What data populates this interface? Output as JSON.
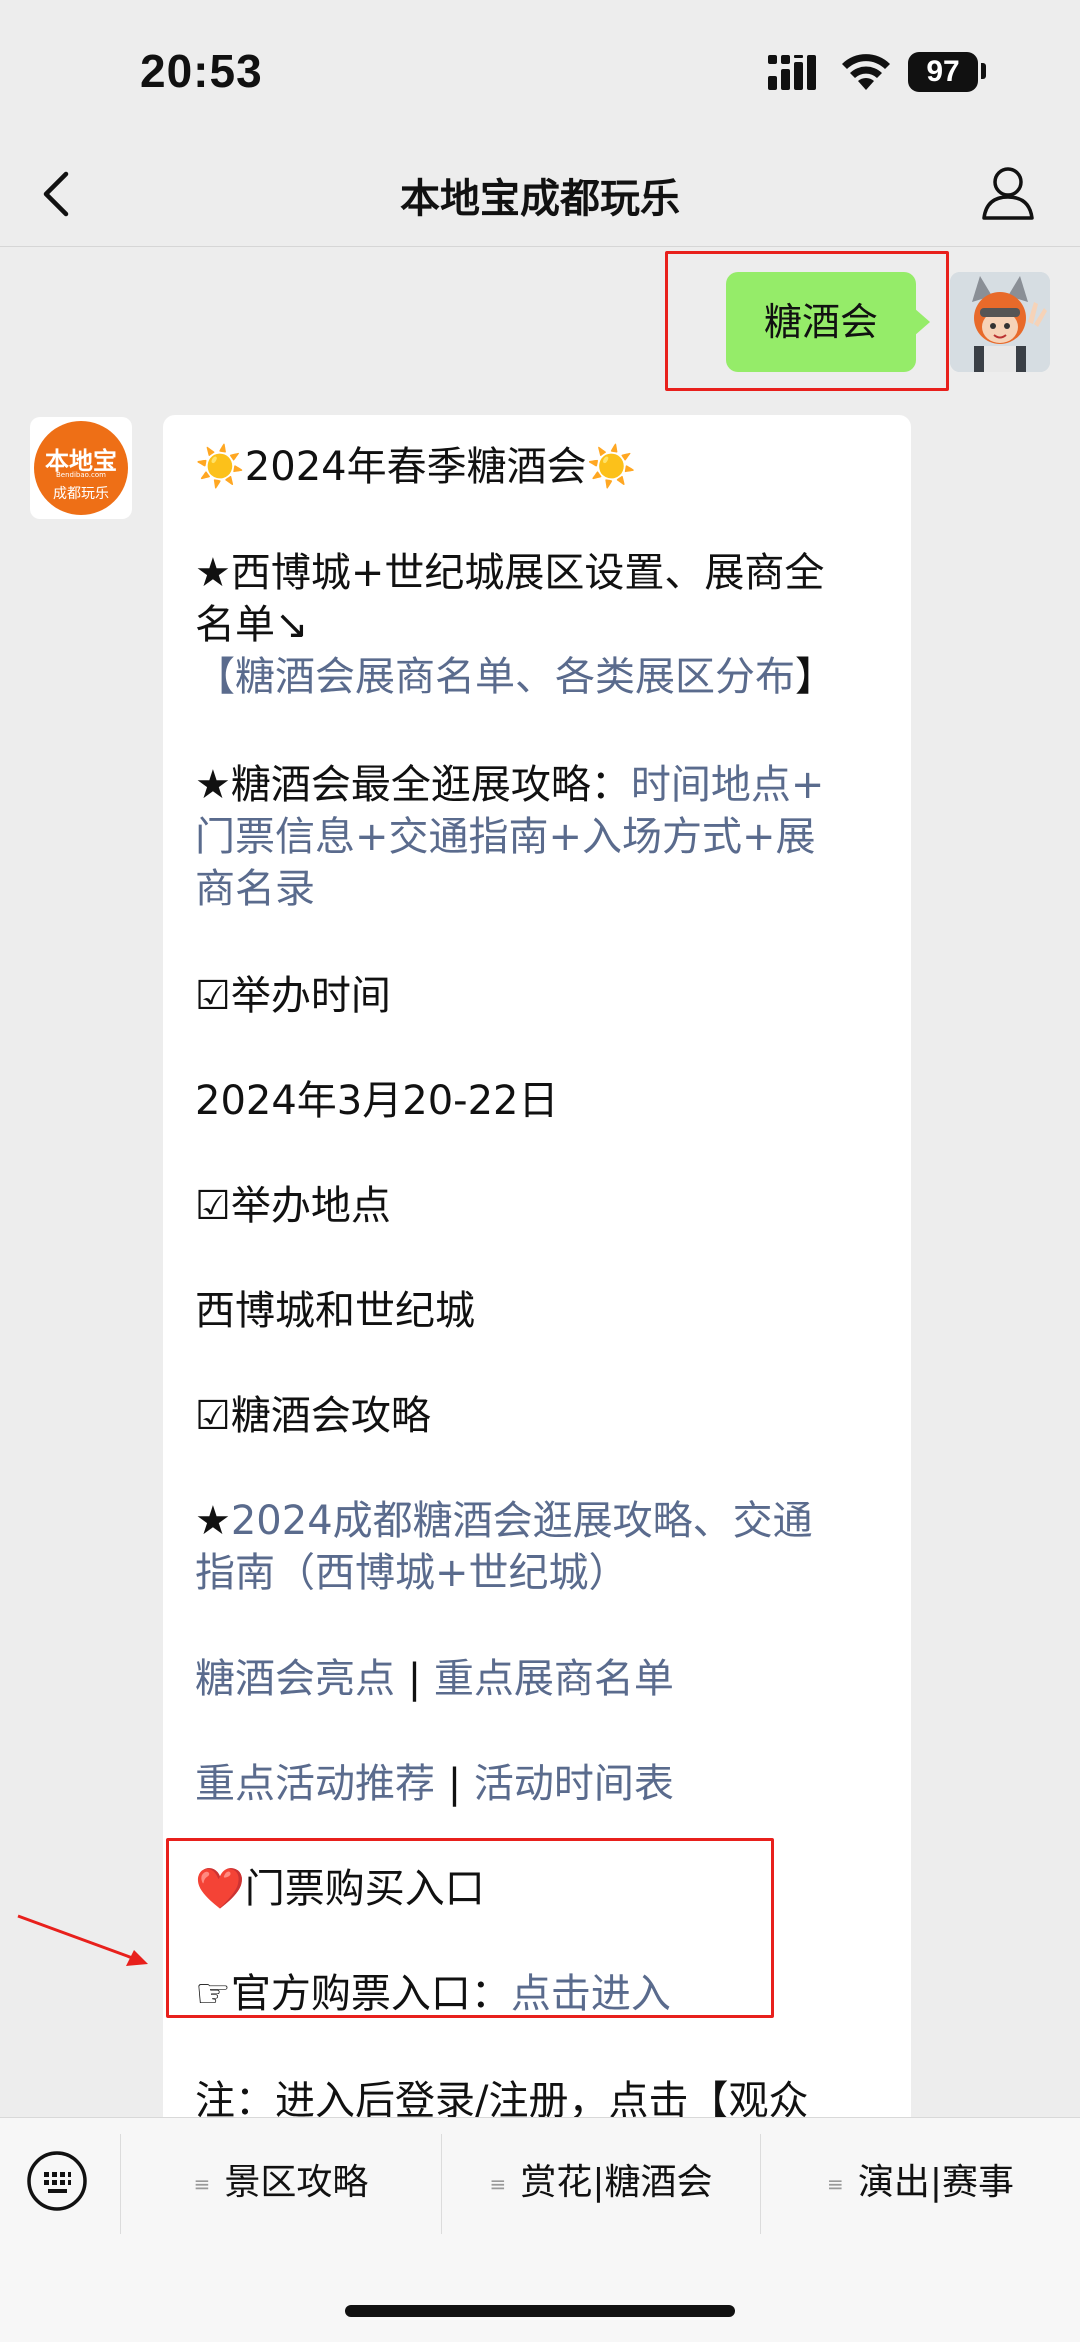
{
  "status": {
    "time": "20:53",
    "battery": "97"
  },
  "nav": {
    "title": "本地宝成都玩乐"
  },
  "sent_message": {
    "text": "糖酒会"
  },
  "bot_avatar": {
    "logo_top": "本地宝",
    "logo_url": "Bendibao.com",
    "logo_bottom": "成都玩乐"
  },
  "message": {
    "l1": "☀️2024年春季糖酒会☀️",
    "l2a": "★西博城+世纪城展区设置、展商全",
    "l2b": "名单↘",
    "l3_open": "【",
    "l3_link": "糖酒会展商名单、各类展区分布",
    "l3_close": "】",
    "l4_prefix": "★糖酒会最全逛展攻略：",
    "l4_link1": "时间地点+",
    "l4_link2": "门票信息+交通指南+入场方式+展",
    "l4_link3": "商名录",
    "time_label": "☑举办时间",
    "time_value": "2024年3月20-22日",
    "place_label": "☑举办地点",
    "place_value": "西博城和世纪城",
    "guide_label": "☑糖酒会攻略",
    "guide_star": "★",
    "guide_link1": "2024成都糖酒会逛展攻略、交通",
    "guide_link2": "指南（西博城+世纪城）",
    "hl_link1": "糖酒会亮点",
    "hl_sep": " | ",
    "hl_link2": "重点展商名单",
    "act_link1": "重点活动推荐",
    "act_sep": " | ",
    "act_link2": "活动时间表",
    "ticket_title": "❤️门票购买入口",
    "official_prefix": "☞官方购票入口：",
    "official_link": "点击进入",
    "note": "注：进入后登录/注册，点击【观众"
  },
  "menu": {
    "items": [
      "景区攻略",
      "赏花|糖酒会",
      "演出|赛事"
    ]
  },
  "colors": {
    "bubble_out": "#95ec69",
    "link": "#5a6b8d",
    "highlight": "#e8201c",
    "logo": "#ee6f16"
  }
}
